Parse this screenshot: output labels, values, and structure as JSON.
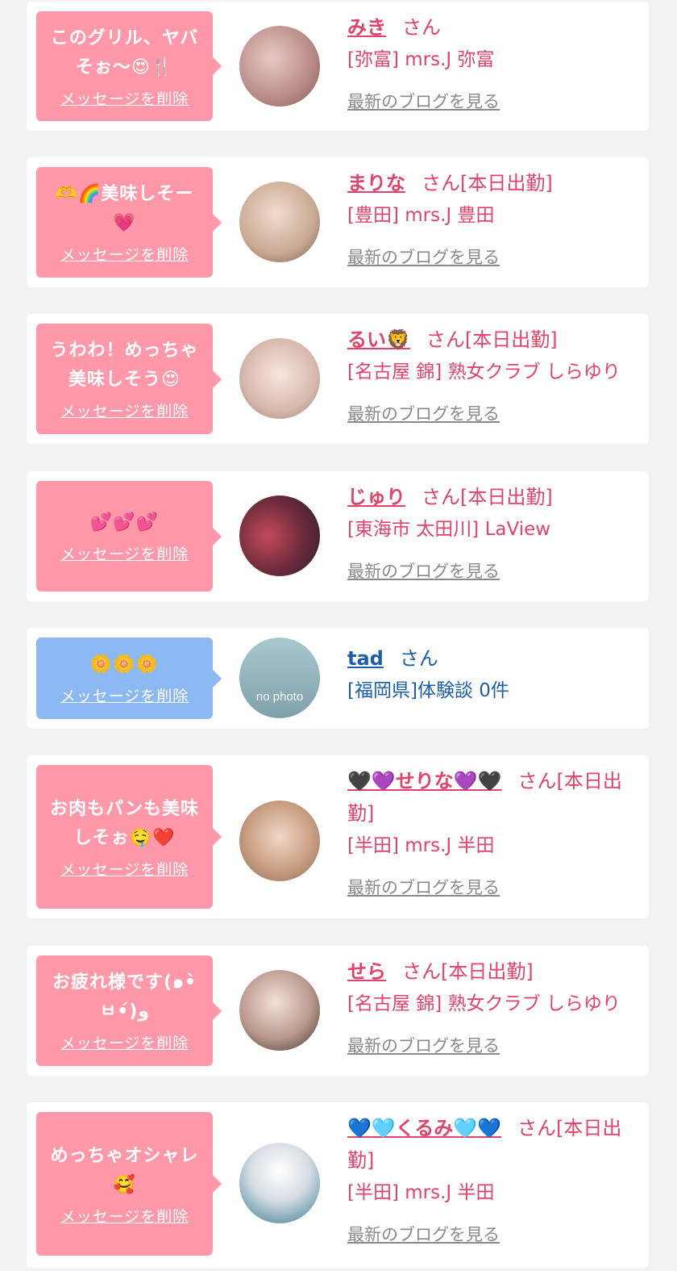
{
  "delete_label": "メッセージを削除",
  "blog_label": "最新のブログを見る",
  "san_suffix": "さん",
  "items": [
    {
      "message": "このグリル、ヤバそぉ～😍🍴",
      "name": "みき",
      "san": "さん",
      "shop": "[弥富] mrs.J 弥富",
      "color": "pink"
    },
    {
      "message": "🫶🌈美味しそー💗",
      "name": "まりな",
      "san": "さん[本日出勤]",
      "shop": "[豊田] mrs.J 豊田",
      "color": "pink"
    },
    {
      "message": "うわわ！めっちゃ美味しそう😍",
      "name": "るい🦁",
      "san": "さん[本日出勤]",
      "shop": "[名古屋 錦] 熟女クラブ しらゆり",
      "color": "pink"
    },
    {
      "message": "💕💕💕",
      "name": "じゅり",
      "san": "さん[本日出勤]",
      "shop": "[東海市 太田川] LaView",
      "color": "pink"
    },
    {
      "message": "🌼🌼🌼",
      "name": "tad",
      "san": "さん",
      "shop": "[福岡県]体験談 0件",
      "color": "blue",
      "avatar_text": "no photo"
    },
    {
      "message": "お肉もパンも美味しそぉ🤤❤️",
      "name": "🖤💜せりな💜🖤",
      "san": "さん[本日出勤]",
      "shop": "[半田] mrs.J 半田",
      "color": "pink"
    },
    {
      "message": "お疲れ様です(๑•̀ㅂ•́)و",
      "name": "せら",
      "san": "さん[本日出勤]",
      "shop": "[名古屋 錦] 熟女クラブ しらゆり",
      "color": "pink"
    },
    {
      "message": "めっちゃオシャレ🥰",
      "name": "💙🩵くるみ🩵💙",
      "san": "さん[本日出勤]",
      "shop": "[半田] mrs.J 半田",
      "color": "pink"
    }
  ]
}
